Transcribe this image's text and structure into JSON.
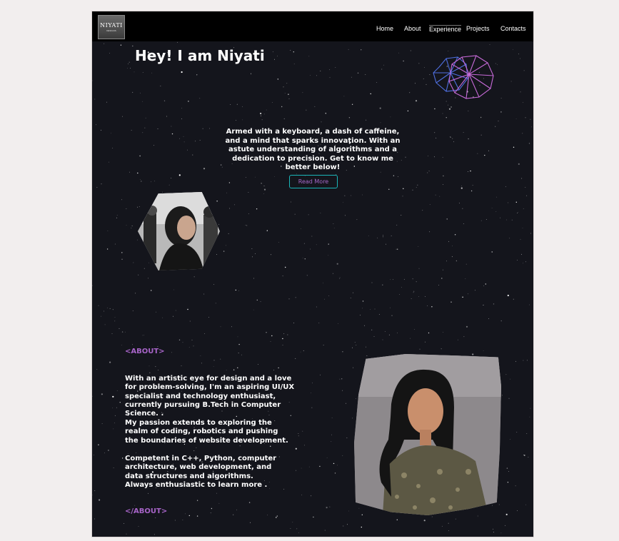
{
  "nav": {
    "logo": {
      "main": "NIYATI",
      "sub": "DESIGNS"
    },
    "links": [
      "Home",
      "About",
      "Experience",
      "Projects",
      "Contacts"
    ],
    "active_link": "Experience"
  },
  "hero": {
    "title": "Hey! I am Niyati",
    "intro": "Armed with a keyboard, a dash of caffeine, and a mind that sparks innovation. With an astute understanding of algorithms and a dedication to precision. Get to know me better below!",
    "read_more": "Read More"
  },
  "about": {
    "open_tag": "<ABOUT>",
    "paragraphs": [
      "With an artistic eye for design and a love for problem-solving, I'm an aspiring UI/UX specialist and technology enthusiast, currently pursuing B.Tech in Computer Science. .",
      "My passion extends to exploring the realm of coding, robotics and pushing the boundaries of website development.",
      "Competent in C++, Python, computer architecture, web development, and data structures and algorithms. Always enthusiastic to learn more ."
    ],
    "close_tag": "</ABOUT>"
  },
  "colors": {
    "background": "#14151c",
    "nav": "#000000",
    "accent_purple": "#a764c8",
    "button_border": "#1ab6b9"
  },
  "icons": [
    "logo",
    "geometric-polyhedron-icon",
    "hexagon-photo",
    "portrait-photo"
  ]
}
